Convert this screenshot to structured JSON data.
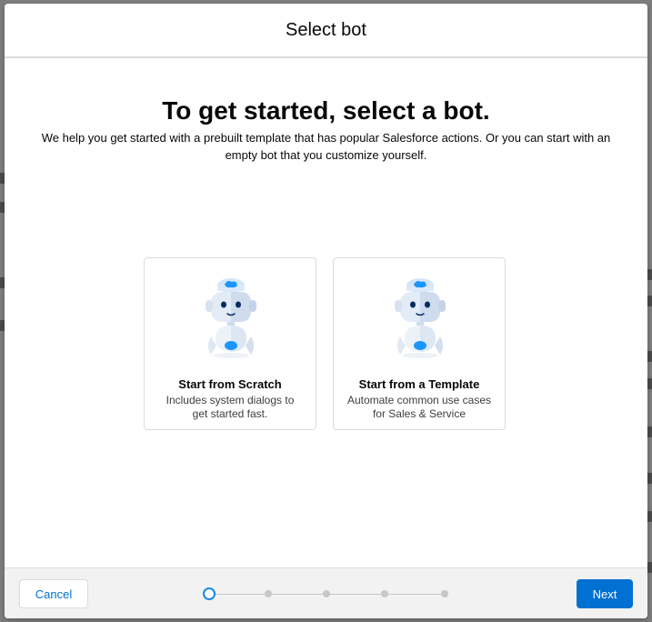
{
  "modal": {
    "title": "Select bot"
  },
  "body": {
    "headline": "To get started, select a bot.",
    "subtext": "We help you get started with a prebuilt template that has popular Salesforce actions. Or you can start with an empty bot that you customize yourself."
  },
  "cards": [
    {
      "title": "Start from Scratch",
      "description": "Includes system dialogs to get started fast.",
      "icon": "bot-icon"
    },
    {
      "title": "Start from a Template",
      "description": "Automate common use cases for Sales & Service",
      "icon": "bot-icon"
    }
  ],
  "footer": {
    "cancel_label": "Cancel",
    "next_label": "Next"
  },
  "progress": {
    "total_steps": 5,
    "current_step": 1
  },
  "colors": {
    "brand": "#0070d2",
    "active_step": "#1589ee",
    "bot_accent": "#1b96ff"
  }
}
